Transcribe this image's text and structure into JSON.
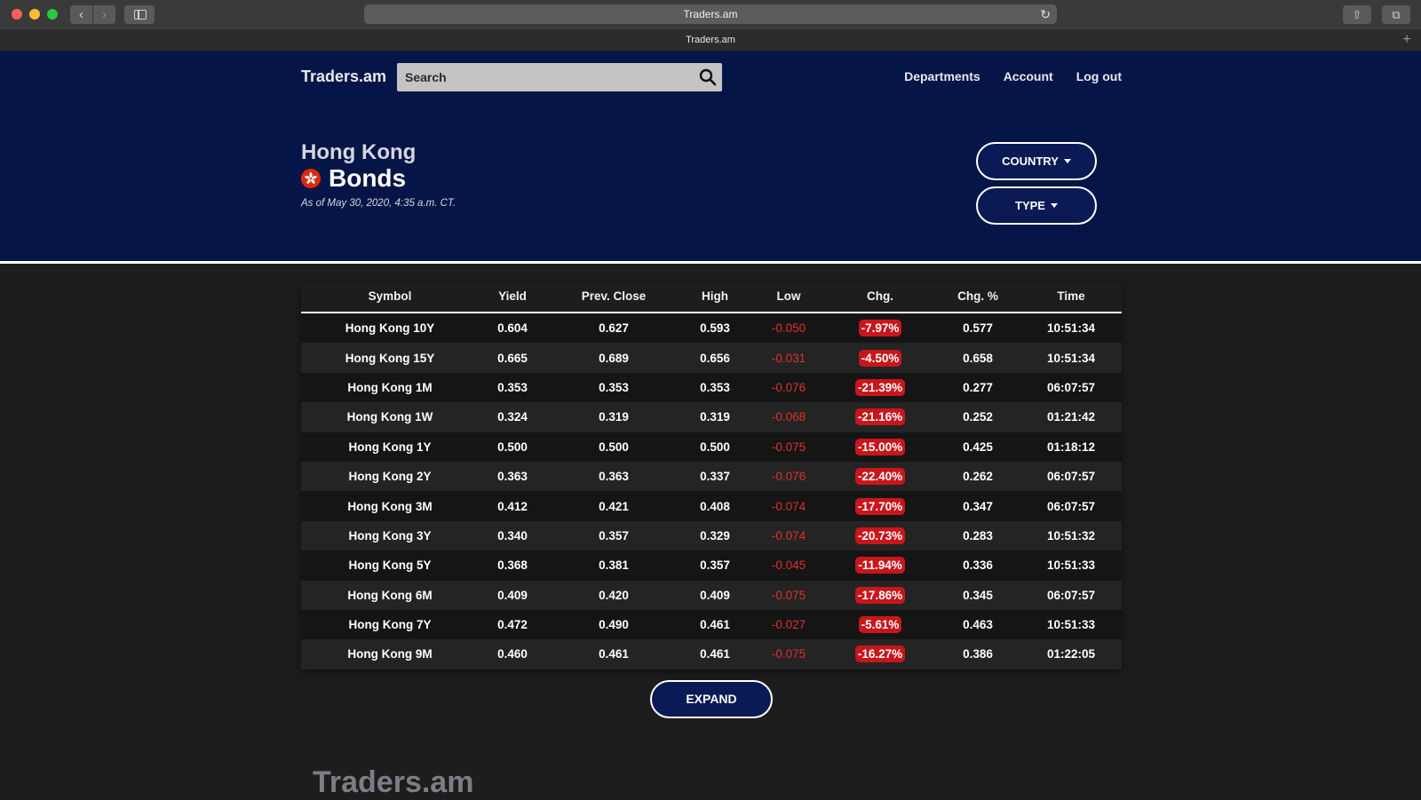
{
  "browser": {
    "address": "Traders.am",
    "tab_title": "Traders.am"
  },
  "header": {
    "logo": "Traders.am",
    "search_placeholder": "Search",
    "nav": [
      "Departments",
      "Account",
      "Log out"
    ]
  },
  "hero": {
    "region": "Hong Kong",
    "title": "Bonds",
    "as_of": "As of May 30, 2020, 4:35 a.m. CT.",
    "country_button": "COUNTRY",
    "type_button": "TYPE"
  },
  "table": {
    "columns": [
      "Symbol",
      "Yield",
      "Prev. Close",
      "High",
      "Low",
      "Chg.",
      "Chg. %",
      "Time"
    ],
    "rows": [
      [
        "Hong Kong 10Y",
        "0.604",
        "0.627",
        "0.593",
        "-0.050",
        "-7.97%",
        "0.577",
        "10:51:34"
      ],
      [
        "Hong Kong 15Y",
        "0.665",
        "0.689",
        "0.656",
        "-0.031",
        "-4.50%",
        "0.658",
        "10:51:34"
      ],
      [
        "Hong Kong 1M",
        "0.353",
        "0.353",
        "0.353",
        "-0.076",
        "-21.39%",
        "0.277",
        "06:07:57"
      ],
      [
        "Hong Kong 1W",
        "0.324",
        "0.319",
        "0.319",
        "-0.068",
        "-21.16%",
        "0.252",
        "01:21:42"
      ],
      [
        "Hong Kong 1Y",
        "0.500",
        "0.500",
        "0.500",
        "-0.075",
        "-15.00%",
        "0.425",
        "01:18:12"
      ],
      [
        "Hong Kong 2Y",
        "0.363",
        "0.363",
        "0.337",
        "-0.076",
        "-22.40%",
        "0.262",
        "06:07:57"
      ],
      [
        "Hong Kong 3M",
        "0.412",
        "0.421",
        "0.408",
        "-0.074",
        "-17.70%",
        "0.347",
        "06:07:57"
      ],
      [
        "Hong Kong 3Y",
        "0.340",
        "0.357",
        "0.329",
        "-0.074",
        "-20.73%",
        "0.283",
        "10:51:32"
      ],
      [
        "Hong Kong 5Y",
        "0.368",
        "0.381",
        "0.357",
        "-0.045",
        "-11.94%",
        "0.336",
        "10:51:33"
      ],
      [
        "Hong Kong 6M",
        "0.409",
        "0.420",
        "0.409",
        "-0.075",
        "-17.86%",
        "0.345",
        "06:07:57"
      ],
      [
        "Hong Kong 7Y",
        "0.472",
        "0.490",
        "0.461",
        "-0.027",
        "-5.61%",
        "0.463",
        "10:51:33"
      ],
      [
        "Hong Kong 9M",
        "0.460",
        "0.461",
        "0.461",
        "-0.075",
        "-16.27%",
        "0.386",
        "01:22:05"
      ]
    ]
  },
  "expand_button": "EXPAND",
  "footer": {
    "logo": "Traders.am"
  },
  "colors": {
    "hero_bg": "#061547",
    "negative": "#e0302b",
    "badge_bg": "#c8161c",
    "page_bg": "#1d1d1d"
  }
}
